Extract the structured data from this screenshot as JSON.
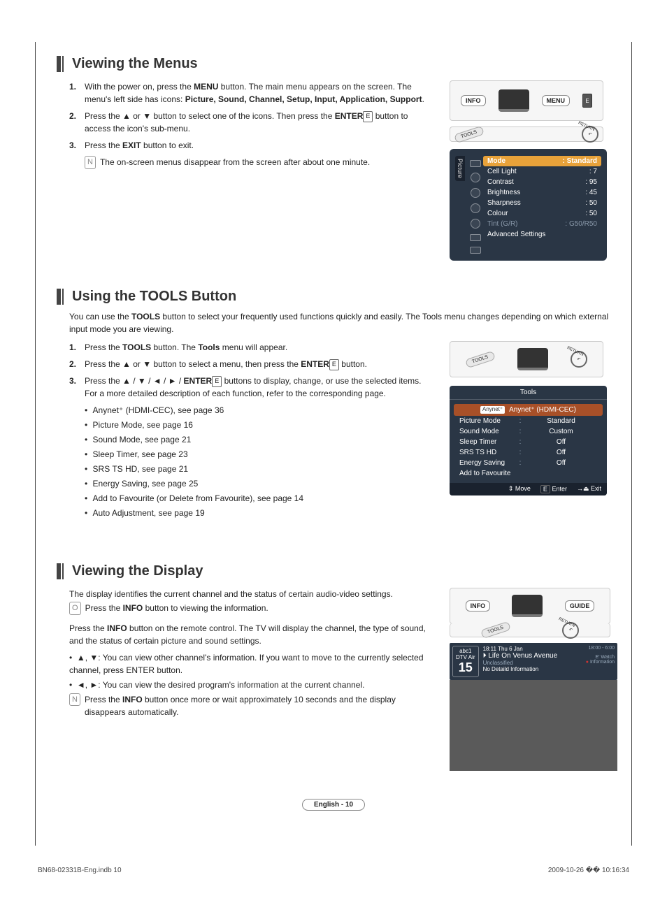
{
  "sections": {
    "menus": {
      "title": "Viewing the Menus",
      "steps": [
        {
          "num": "1.",
          "pre": "With the power on, press the ",
          "bold1": "MENU",
          "mid": " button. The main menu appears on the screen. The menu's left side has icons: ",
          "bold2": "Picture, Sound, Channel, Setup, Input, Application, Support",
          "post": "."
        },
        {
          "num": "2.",
          "pre": "Press the ▲ or ▼ button to select one of the icons. Then press the  ",
          "bold1": "ENTER",
          "mid": "",
          "bold2": "",
          "post": " button to access the icon's sub-menu.",
          "enter_icon": "E"
        },
        {
          "num": "3.",
          "pre": "Press the ",
          "bold1": "EXIT",
          "mid": "",
          "bold2": "",
          "post": " button to exit."
        }
      ],
      "note": "The on-screen menus disappear from the screen after about one minute."
    },
    "tools": {
      "title": "Using the TOOLS Button",
      "intro_pre": "You can use the ",
      "intro_bold": "TOOLS",
      "intro_post": " button to select your frequently used functions quickly and easily. The Tools menu changes depending on which external input mode you are viewing.",
      "steps": [
        {
          "num": "1.",
          "pre": "Press the ",
          "bold1": "TOOLS",
          "mid": " button. The ",
          "bold2": "Tools",
          "post": " menu will appear."
        },
        {
          "num": "2.",
          "pre": "Press the ▲ or ▼ button to select a menu, then press the ",
          "bold1": "ENTER",
          "post": " button.",
          "enter_icon": "E"
        },
        {
          "num": "3.",
          "pre": "Press the ▲ / ▼ / ◄ / ► / ",
          "bold1": "ENTER",
          "post": " buttons to display, change, or use the selected items. For a more detailed description of each function, refer to the corresponding page.",
          "enter_icon": "E"
        }
      ],
      "bullets": [
        "Anynet⁺ (HDMI-CEC), see page 36",
        "Picture Mode, see page 16",
        "Sound Mode, see page 21",
        "Sleep Timer, see page 23",
        "SRS TS HD, see page 21",
        "Energy Saving, see page 25",
        "Add to Favourite (or Delete from Favourite), see page 14",
        "Auto Adjustment, see page 19"
      ]
    },
    "display": {
      "title": "Viewing the Display",
      "line1": "The display identifies the current channel and the status of certain audio-video settings.",
      "info_pre": "Press the ",
      "info_bold": "INFO",
      "info_post": " button to viewing the information.",
      "para_pre": "Press the ",
      "para_bold": "INFO",
      "para_post": " button on the remote control. The TV will display the channel, the type of sound, and the status of certain picture and sound settings.",
      "bullets": [
        "▲, ▼: You can view other channel's information. If you want to move to the currently selected channel, press ENTER button.",
        "◄, ►: You can view the desired program's information at the current channel."
      ],
      "note_pre": "Press the ",
      "note_bold": "INFO",
      "note_post": " button once more or wait approximately 10 seconds and the display disappears automatically."
    }
  },
  "osd": {
    "tab": "Picture",
    "rows": [
      {
        "label": "Mode",
        "value": ": Standard",
        "sel": true
      },
      {
        "label": "Cell Light",
        "value": ": 7"
      },
      {
        "label": "Contrast",
        "value": ": 95"
      },
      {
        "label": "Brightness",
        "value": ": 45"
      },
      {
        "label": "Sharpness",
        "value": ": 50"
      },
      {
        "label": "Colour",
        "value": ": 50"
      },
      {
        "label": "Tint (G/R)",
        "value": ": G50/R50",
        "dim": true
      },
      {
        "label": "Advanced Settings",
        "value": ""
      }
    ]
  },
  "tools_menu": {
    "header": "Tools",
    "selected": "Anynet⁺ (HDMI-CEC)",
    "rows": [
      {
        "label": "Picture Mode",
        "value": "Standard"
      },
      {
        "label": "Sound Mode",
        "value": "Custom"
      },
      {
        "label": "Sleep Timer",
        "value": "Off"
      },
      {
        "label": "SRS TS HD",
        "value": "Off"
      },
      {
        "label": "Energy Saving",
        "value": "Off"
      },
      {
        "label": "Add to Favourite",
        "value": ""
      }
    ],
    "footer": {
      "move": "Move",
      "enter": "Enter",
      "exit": "Exit"
    },
    "footer_pre": {
      "move": "⇕",
      "enter": "E",
      "exit": "→⏏"
    }
  },
  "remote": {
    "info": "INFO",
    "menu": "MENU",
    "guide": "GUIDE",
    "e": "E",
    "tools": "TOOLS"
  },
  "info_panel": {
    "ch_label": "DTV Air",
    "ch_name": "abc1",
    "ch_num": "15",
    "datetime": "18:11 Thu 6 Jan",
    "program": "Life On Venus Avenue",
    "genre": "Unclassified",
    "detail": "No Detaild Information",
    "time": "18:00 - 6:00",
    "watch": "Watch",
    "info": "Information"
  },
  "footer": {
    "lang": "English - 10",
    "left": "BN68-02331B-Eng.indb   10",
    "right": "2009-10-26   �� 10:16:34"
  }
}
